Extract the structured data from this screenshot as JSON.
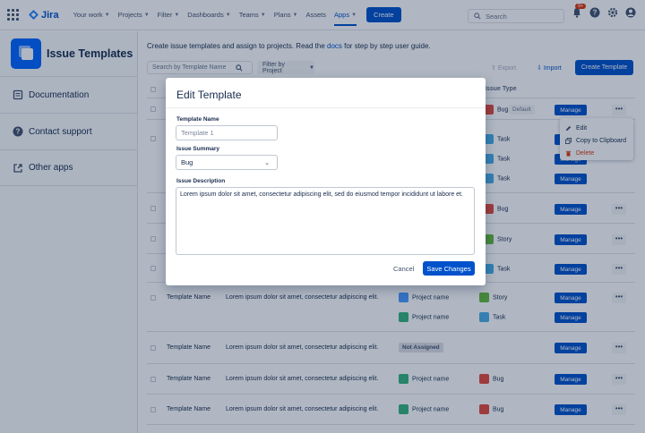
{
  "topnav": {
    "logo": "Jira",
    "items": [
      "Your work",
      "Projects",
      "Filter",
      "Dashboards",
      "Teams",
      "Plans",
      "Assets",
      "Apps"
    ],
    "create": "Create",
    "search_placeholder": "Search",
    "notifications": "9+"
  },
  "sidebar": {
    "title": "Issue Templates",
    "items": [
      "Documentation",
      "Contact support",
      "Other apps"
    ]
  },
  "main": {
    "intro_before": "Create issue templates and assign to projects. Read the ",
    "intro_link": "docs",
    "intro_after": " for step by step user guide.",
    "search_placeholder": "Search by Template Name",
    "filter": "Filter by Project",
    "export": "Export",
    "import": "Import",
    "create_template": "Create Template",
    "col_issue_type": "Issue Type",
    "row_name": "Template Name",
    "row_desc": "Lorem ipsum dolor sit amet, consectetur adipiscing elit.",
    "project_name": "Project name",
    "not_assigned": "Not Assigned",
    "manage": "Manage",
    "more": "•••",
    "type_bug": "Bug",
    "type_task": "Task",
    "type_story": "Story",
    "default_tag": "Default"
  },
  "menu": {
    "items": [
      "Edit",
      "Copy to Clipboard",
      "Delete"
    ]
  },
  "modal": {
    "title": "Edit Template",
    "name_label": "Template Name",
    "name_placeholder": "Template 1",
    "summary_label": "Issue Summary",
    "summary_value": "Bug",
    "desc_label": "Issue Description",
    "desc_value": "Lorem ipsum dolor sit amet, consectetur adipiscing elit, sed do eiusmod tempor incididunt ut labore et.",
    "cancel": "Cancel",
    "save": "Save Changes"
  },
  "colors": {
    "primary": "#0052cc",
    "bug": "#e5493a",
    "task": "#4bade8",
    "story": "#63ba3c"
  }
}
